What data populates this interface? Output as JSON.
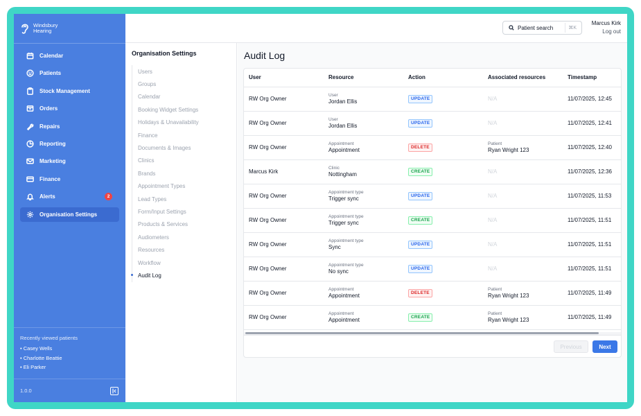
{
  "brand": {
    "line1": "Windsbury",
    "line2": "Hearing"
  },
  "nav": [
    {
      "label": "Calendar",
      "icon": "calendar-icon"
    },
    {
      "label": "Patients",
      "icon": "smile-icon"
    },
    {
      "label": "Stock Management",
      "icon": "clipboard-icon"
    },
    {
      "label": "Orders",
      "icon": "box-icon"
    },
    {
      "label": "Repairs",
      "icon": "wrench-icon"
    },
    {
      "label": "Reporting",
      "icon": "pie-chart-icon"
    },
    {
      "label": "Marketing",
      "icon": "mail-icon"
    },
    {
      "label": "Finance",
      "icon": "credit-card-icon"
    },
    {
      "label": "Alerts",
      "icon": "bell-icon",
      "badge": "2"
    },
    {
      "label": "Organisation Settings",
      "icon": "gear-icon",
      "active": true
    }
  ],
  "recent": {
    "title": "Recently viewed patients",
    "items": [
      "• Casey Wells",
      "• Charlotte Beattie",
      "• Eli Parker"
    ]
  },
  "version": "1.0.0",
  "topbar": {
    "search_label": "Patient search",
    "shortcut": "⌘K",
    "user_name": "Marcus Kirk",
    "logout": "Log out"
  },
  "settings": {
    "title": "Organisation Settings",
    "items": [
      "Users",
      "Groups",
      "Calendar",
      "Booking Widget Settings",
      "Holidays & Unavailability",
      "Finance",
      "Documents & Images",
      "Clinics",
      "Brands",
      "Appointment Types",
      "Lead Types",
      "Form/Input Settings",
      "Products & Services",
      "Audiometers",
      "Resources",
      "Workflow",
      "Audit Log"
    ],
    "active": "Audit Log"
  },
  "audit": {
    "title": "Audit Log",
    "columns": [
      "User",
      "Resource",
      "Action",
      "Associated resources",
      "Timestamp"
    ],
    "rows": [
      {
        "user": "RW Org Owner",
        "res_type": "User",
        "res_name": "Jordan Ellis",
        "action": "UPDATE",
        "assoc_type": "",
        "assoc_name": "N/A",
        "ts": "11/07/2025, 12:45"
      },
      {
        "user": "RW Org Owner",
        "res_type": "User",
        "res_name": "Jordan Ellis",
        "action": "UPDATE",
        "assoc_type": "",
        "assoc_name": "N/A",
        "ts": "11/07/2025, 12:41"
      },
      {
        "user": "RW Org Owner",
        "res_type": "Appointment",
        "res_name": "Appointment",
        "action": "DELETE",
        "assoc_type": "Patient",
        "assoc_name": "Ryan Wright 123",
        "ts": "11/07/2025, 12:40"
      },
      {
        "user": "Marcus Kirk",
        "res_type": "Clinic",
        "res_name": "Nottingham",
        "action": "CREATE",
        "assoc_type": "",
        "assoc_name": "N/A",
        "ts": "11/07/2025, 12:36"
      },
      {
        "user": "RW Org Owner",
        "res_type": "Appointment type",
        "res_name": "Trigger sync",
        "action": "UPDATE",
        "assoc_type": "",
        "assoc_name": "N/A",
        "ts": "11/07/2025, 11:53"
      },
      {
        "user": "RW Org Owner",
        "res_type": "Appointment type",
        "res_name": "Trigger sync",
        "action": "CREATE",
        "assoc_type": "",
        "assoc_name": "N/A",
        "ts": "11/07/2025, 11:51"
      },
      {
        "user": "RW Org Owner",
        "res_type": "Appointment type",
        "res_name": "Sync",
        "action": "UPDATE",
        "assoc_type": "",
        "assoc_name": "N/A",
        "ts": "11/07/2025, 11:51"
      },
      {
        "user": "RW Org Owner",
        "res_type": "Appointment type",
        "res_name": "No sync",
        "action": "UPDATE",
        "assoc_type": "",
        "assoc_name": "N/A",
        "ts": "11/07/2025, 11:51"
      },
      {
        "user": "RW Org Owner",
        "res_type": "Appointment",
        "res_name": "Appointment",
        "action": "DELETE",
        "assoc_type": "Patient",
        "assoc_name": "Ryan Wright 123",
        "ts": "11/07/2025, 11:49"
      },
      {
        "user": "RW Org Owner",
        "res_type": "Appointment",
        "res_name": "Appointment",
        "action": "CREATE",
        "assoc_type": "Patient",
        "assoc_name": "Ryan Wright 123",
        "ts": "11/07/2025, 11:49"
      }
    ],
    "prev_label": "Previous",
    "next_label": "Next"
  },
  "colors": {
    "sidebar": "#4a7fe0",
    "frame": "#3fd6c6",
    "accent": "#3b78e7",
    "update": "#2563eb",
    "delete": "#dc2626",
    "create": "#16a34a"
  }
}
